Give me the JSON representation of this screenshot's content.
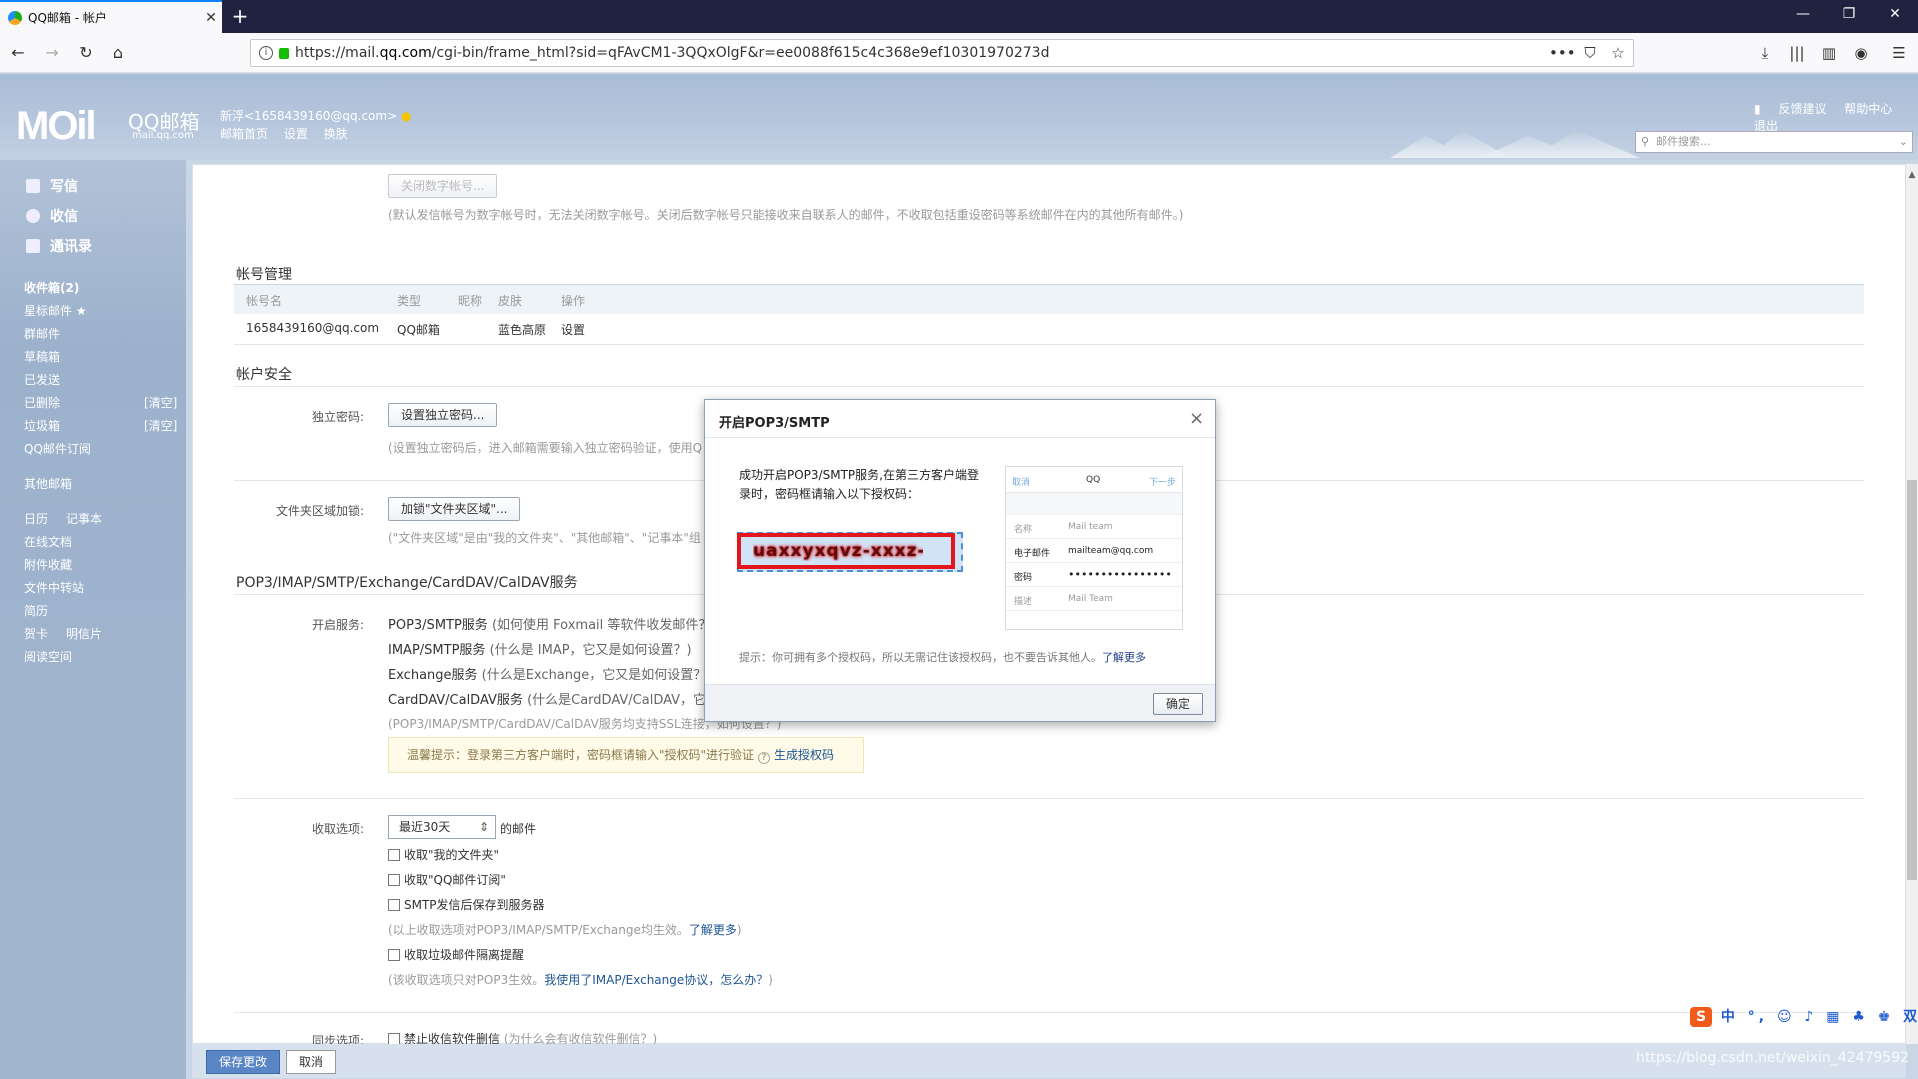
{
  "browser": {
    "tab_title": "QQ邮箱 - 帐户",
    "url_prefix": "https://mail.",
    "url_domain": "qq.com",
    "url_rest": "/cgi-bin/frame_html?sid=qFAvCM1-3QQxOlgF&r=ee0088f615c4c368e9ef10301970273d"
  },
  "header": {
    "logo_text": "MOil",
    "logo_cn": "QQ邮箱",
    "logo_domain": "mail.qq.com",
    "account": "新浮<1658439160@qq.com>",
    "links": [
      "邮箱首页",
      "设置",
      "换肤"
    ],
    "top_links": [
      "反馈建议",
      "帮助中心",
      "退出"
    ],
    "search_placeholder": "邮件搜索..."
  },
  "sidebar": {
    "main": [
      "写信",
      "收信",
      "通讯录"
    ],
    "folders": [
      {
        "label": "收件箱(2)"
      },
      {
        "label": "星标邮件 ★"
      },
      {
        "label": "群邮件"
      },
      {
        "label": "草稿箱"
      },
      {
        "label": "已发送"
      },
      {
        "label": "已删除",
        "action": "[清空]"
      },
      {
        "label": "垃圾箱",
        "action": "[清空]"
      },
      {
        "label": "QQ邮件订阅"
      }
    ],
    "other": "其他邮箱",
    "tools": [
      "日历",
      "记事本",
      "在线文档",
      "附件收藏",
      "文件中转站",
      "简历",
      "贺卡",
      "明信片",
      "阅读空间"
    ]
  },
  "content": {
    "close_digital_btn": "关闭数字帐号...",
    "close_digital_note": "(默认发信帐号为数字帐号时，无法关闭数字帐号。关闭后数字帐号只能接收来自联系人的邮件，不收取包括重设密码等系统邮件在内的其他所有邮件。)",
    "acct_mgmt_title": "帐号管理",
    "acct_table_headers": [
      "帐号名",
      "类型",
      "昵称",
      "皮肤",
      "操作"
    ],
    "acct_row": [
      "1658439160@qq.com",
      "QQ邮箱",
      "",
      "蓝色高原",
      "设置"
    ],
    "security_title": "帐户安全",
    "indep_pwd_label": "独立密码:",
    "indep_pwd_btn": "设置独立密码...",
    "indep_pwd_note": "(设置独立密码后，进入邮箱需要输入独立密码验证，使用Q",
    "folder_encrypt_label": "文件夹区域加锁:",
    "folder_encrypt_btn": "加锁\"文件夹区域\"...",
    "folder_encrypt_note": "(\"文件夹区域\"是由\"我的文件夹\"、\"其他邮箱\"、\"记事本\"组",
    "pop_title": "POP3/IMAP/SMTP/Exchange/CardDAV/CalDAV服务",
    "open_service_label": "开启服务:",
    "services": [
      {
        "name": "POP3/SMTP服务",
        "hint": "(如何使用 Foxmail 等软件收发邮件？)"
      },
      {
        "name": "IMAP/SMTP服务",
        "hint": "(什么是 IMAP，它又是如何设置？)"
      },
      {
        "name": "Exchange服务",
        "hint": "(什么是Exchange，它又是如何设置？)"
      },
      {
        "name": "CardDAV/CalDAV服务",
        "hint": "(什么是CardDAV/CalDAV，它又"
      }
    ],
    "ssl_note": "(POP3/IMAP/SMTP/CardDAV/CalDAV服务均支持SSL连接，如何设置？)",
    "warm_tip": "温馨提示：登录第三方客户端时，密码框请输入\"授权码\"进行验证",
    "warm_tip_link": "生成授权码",
    "fetch_label": "收取选项:",
    "fetch_select": "最近30天",
    "fetch_suffix": "的邮件",
    "checkboxes": [
      "收取\"我的文件夹\"",
      "收取\"QQ邮件订阅\"",
      "SMTP发信后保存到服务器"
    ],
    "fetch_note": "(以上收取选项对POP3/IMAP/SMTP/Exchange均生效。",
    "fetch_note_link": "了解更多",
    "spam_cb": "收取垃圾邮件隔离提醒",
    "spam_note": "(该收取选项只对POP3生效。",
    "spam_note_link": "我使用了IMAP/Exchange协议，怎么办？",
    "sync_label": "同步选项:",
    "sync_cb": "禁止收信软件删信",
    "sync_note": "(为什么会有收信软件删信？)",
    "save_btn": "保存更改",
    "cancel_btn": "取消"
  },
  "dialog": {
    "title": "开启POP3/SMTP",
    "message": "成功开启POP3/SMTP服务,在第三方客户端登录时，密码框请输入以下授权码：",
    "auth_code": "uaxxyxqvz-xxxz-cgxi",
    "mock_cancel": "取消",
    "mock_title": "QQ",
    "mock_next": "下一步",
    "mock_rows": [
      {
        "k": "名称",
        "v": "Mail team"
      },
      {
        "k": "电子邮件",
        "v": "mailteam@qq.com"
      },
      {
        "k": "密码",
        "v": "••••••••••••••••"
      },
      {
        "k": "描述",
        "v": "Mail Team"
      }
    ],
    "tip": "提示：你可拥有多个授权码，所以无需记住该授权码，也不要告诉其他人。",
    "tip_link": "了解更多",
    "ok": "确定"
  },
  "ime": {
    "s": "S",
    "text": "中 °, ☺ ♪ ▦ ♣ ♚ 双 ▦"
  },
  "watermark": "https://blog.csdn.net/weixin_42479592"
}
